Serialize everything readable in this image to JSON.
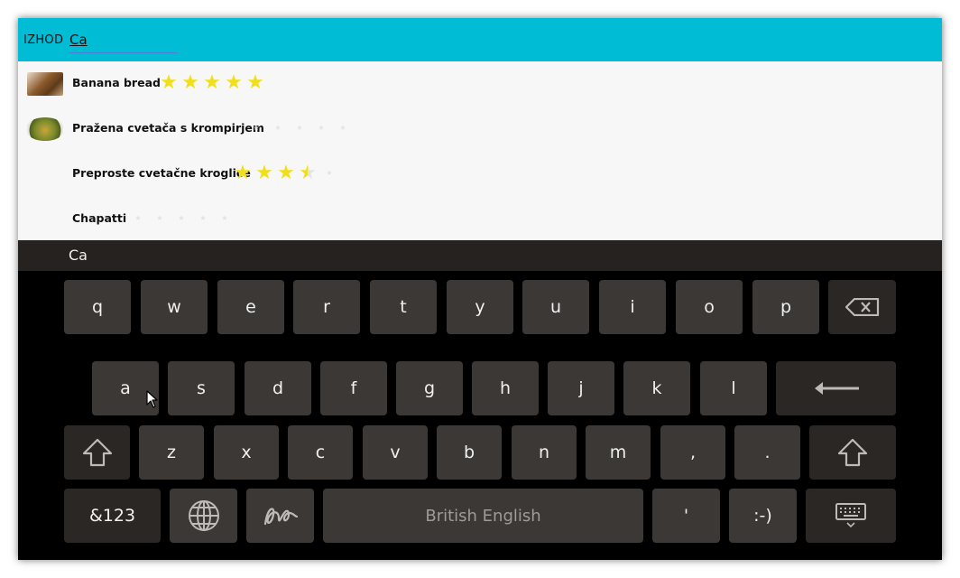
{
  "topbar": {
    "exit_label": "IZHOD",
    "search_value": "Ca"
  },
  "recipes": [
    {
      "title": "Banana bread",
      "rating": 5,
      "max_rating": 5,
      "thumbnail": "banana-bread-thumbnail"
    },
    {
      "title": "Pražena cvetača s krompirjem",
      "rating": 0,
      "max_rating": 5,
      "thumbnail": "cauliflower-thumbnail"
    },
    {
      "title": "Preproste cvetačne kroglice",
      "rating": 3.5,
      "max_rating": 5,
      "thumbnail": ""
    },
    {
      "title": "Chapatti",
      "rating": 0,
      "max_rating": 5,
      "thumbnail": ""
    }
  ],
  "suggestion_bar": {
    "suggestion": "Ca"
  },
  "keyboard": {
    "row1": [
      "q",
      "w",
      "e",
      "r",
      "t",
      "y",
      "u",
      "i",
      "o",
      "p"
    ],
    "row2": [
      "a",
      "s",
      "d",
      "f",
      "g",
      "h",
      "j",
      "k",
      "l"
    ],
    "row3": [
      "z",
      "x",
      "c",
      "v",
      "b",
      "n",
      "m",
      ",",
      "."
    ],
    "symbols_label": "&123",
    "space_label": "British English",
    "apostrophe_label": "'",
    "smiley_label": ":-)"
  },
  "colors": {
    "topbar": "#00bcd4",
    "star_full": "#f2df1c",
    "star_empty": "#e3e3e3",
    "key_bg": "#3b3836",
    "key_dark_bg": "#2a2725",
    "keyboard_bg": "#000000"
  },
  "icons": [
    "backspace-icon",
    "enter-icon",
    "shift-icon",
    "globe-icon",
    "handwriting-icon",
    "hide-keyboard-icon",
    "mouse-cursor-icon"
  ]
}
